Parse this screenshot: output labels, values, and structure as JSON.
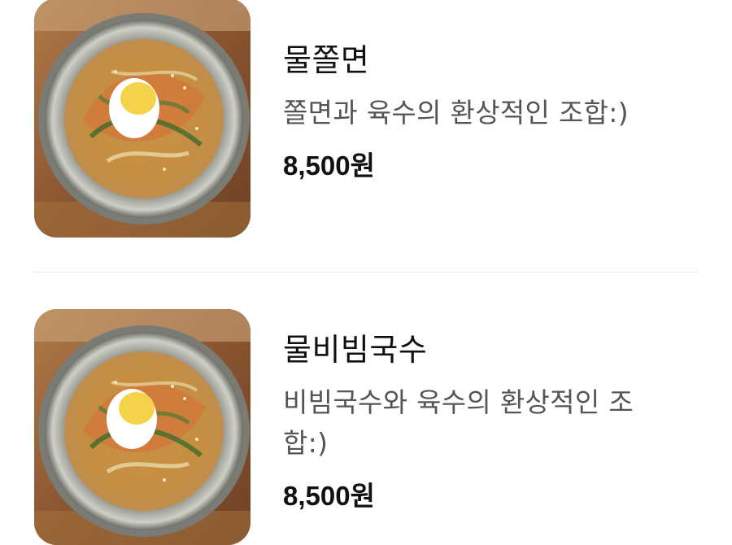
{
  "menu": {
    "items": [
      {
        "name": "물쫄면",
        "description": "쫄면과 육수의 환상적인 조합:)",
        "price": "8,500원",
        "image_icon": "noodle-bowl-photo"
      },
      {
        "name": "물비빔국수",
        "description": "비빔국수와 육수의 환상적인 조합:)",
        "price": "8,500원",
        "image_icon": "noodle-bowl-photo"
      }
    ]
  },
  "colors": {
    "name_text": "#111111",
    "description_text": "#555555",
    "divider": "#e6e6e6",
    "background": "#ffffff"
  }
}
